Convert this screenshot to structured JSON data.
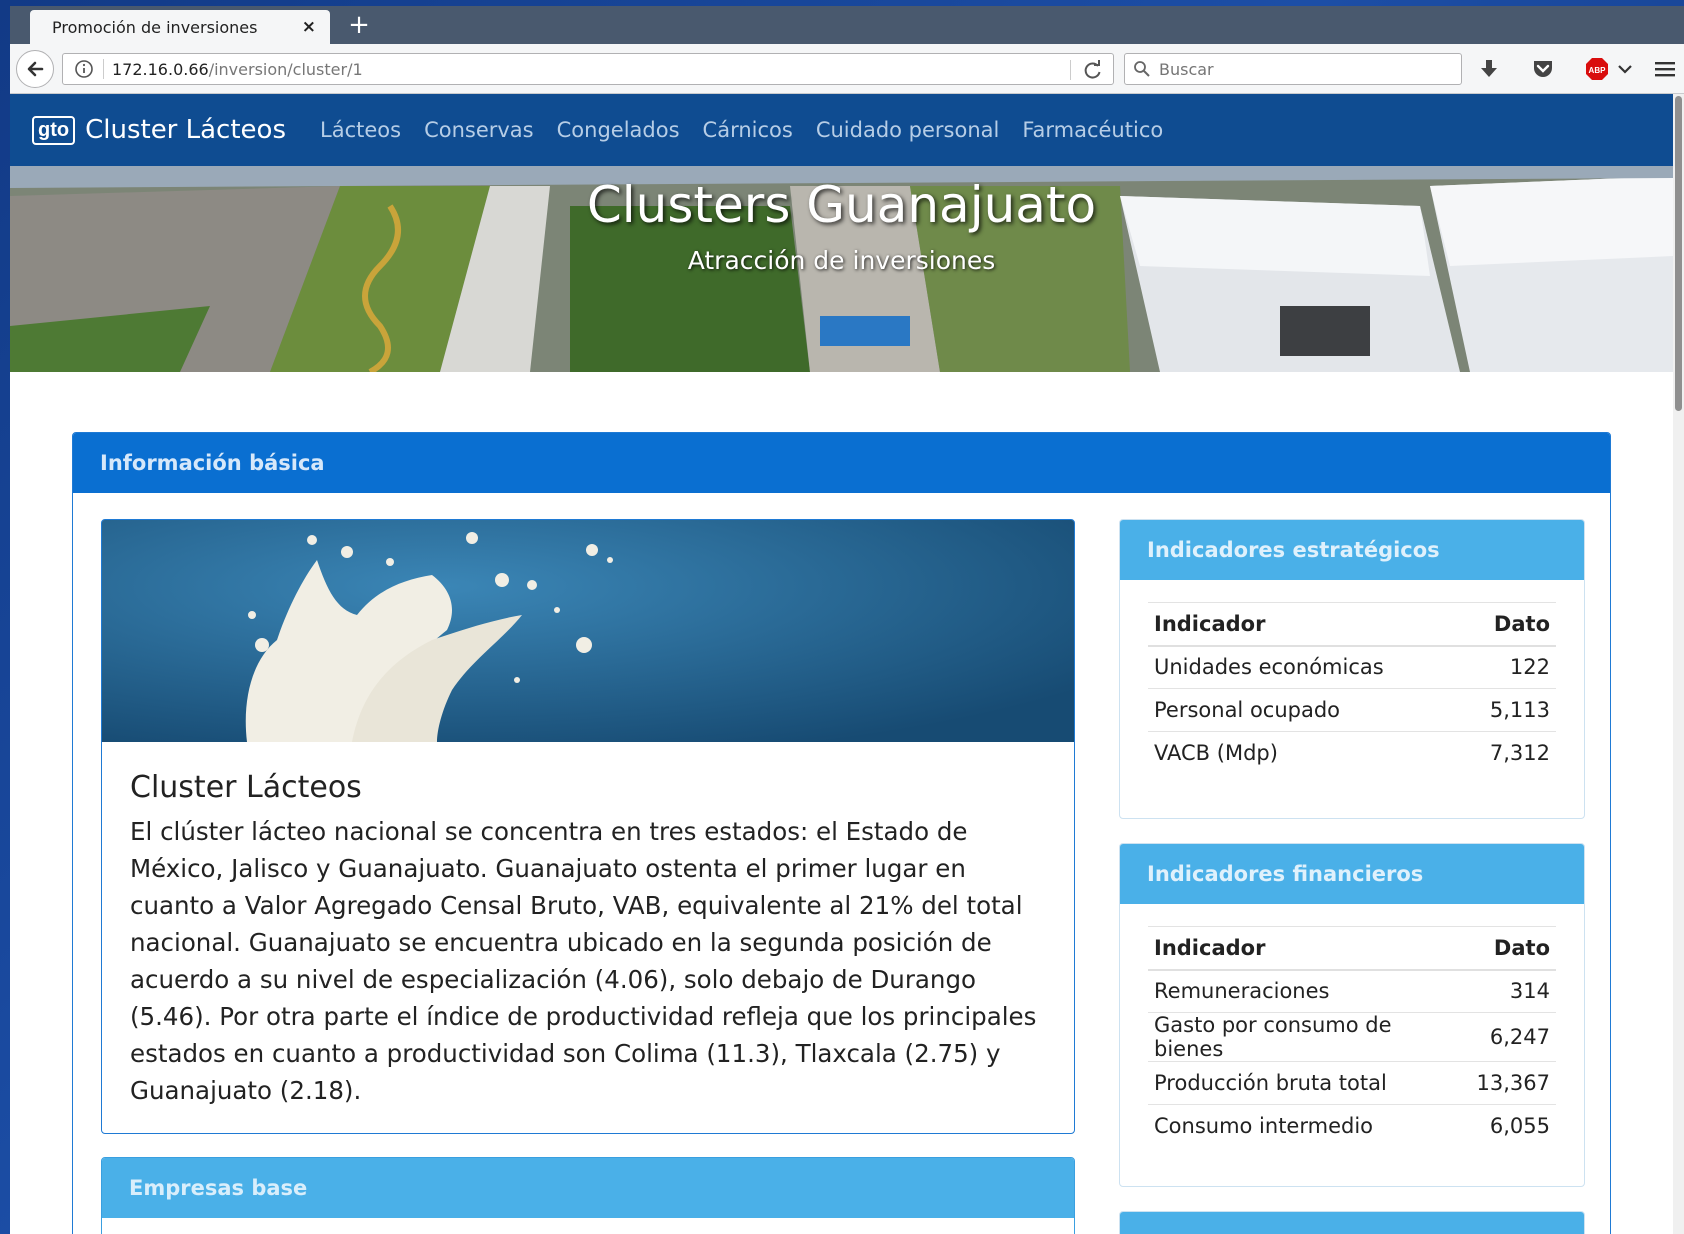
{
  "browser": {
    "tab_title": "Promoción de inversiones",
    "tab_close": "×",
    "new_tab": "+",
    "url_host": "172.16.0.66",
    "url_path": "/inversion/cluster/1",
    "search_placeholder": "Buscar",
    "icons": [
      "back-icon",
      "info-icon",
      "reload-icon",
      "search-icon",
      "download-icon",
      "pocket-icon",
      "adblock-icon",
      "chevron-down-icon",
      "menu-icon"
    ]
  },
  "site": {
    "brand_logo": "gto",
    "brand_name": "Cluster Lácteos",
    "nav": [
      "Lácteos",
      "Conservas",
      "Congelados",
      "Cárnicos",
      "Cuidado personal",
      "Farmacéutico"
    ],
    "hero_title": "Clusters Guanajuato",
    "hero_subtitle": "Atracción de inversiones"
  },
  "main": {
    "panel_title": "Información básica",
    "card_title": "Cluster Lácteos",
    "card_text": "El clúster lácteo nacional se concentra en tres estados: el Estado de México, Jalisco y Guanajuato. Guanajuato ostenta el primer lugar en cuanto a Valor Agregado Censal Bruto, VAB, equivalente al 21% del total nacional. Guanajuato se encuentra ubicado en la segunda posición de acuerdo a su nivel de especialización (4.06), solo debajo de Durango (5.46). Por otra parte el índice de productividad refleja que los principales estados en cuanto a productividad son Colima (11.3), Tlaxcala (2.75) y Guanajuato (2.18).",
    "empresas_title": "Empresas base"
  },
  "estrategicos": {
    "title": "Indicadores estratégicos",
    "col_indicador": "Indicador",
    "col_dato": "Dato",
    "rows": [
      {
        "indicador": "Unidades económicas",
        "dato": "122"
      },
      {
        "indicador": "Personal ocupado",
        "dato": "5,113"
      },
      {
        "indicador": "VACB (Mdp)",
        "dato": "7,312"
      }
    ]
  },
  "financieros": {
    "title": "Indicadores financieros",
    "col_indicador": "Indicador",
    "col_dato": "Dato",
    "rows": [
      {
        "indicador": "Remuneraciones",
        "dato": "314"
      },
      {
        "indicador": "Gasto por consumo de bienes",
        "dato": "6,247"
      },
      {
        "indicador": "Producción bruta total",
        "dato": "13,367"
      },
      {
        "indicador": "Consumo intermedio",
        "dato": "6,055"
      }
    ]
  },
  "colors": {
    "navbar": "#0f4c91",
    "panel_head": "#0a6fd1",
    "side_head": "#4ab0e8"
  }
}
